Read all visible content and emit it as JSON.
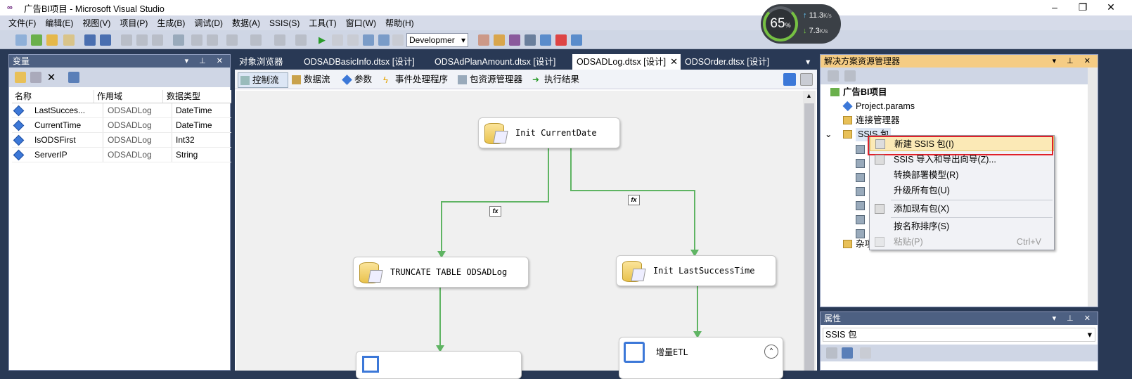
{
  "window": {
    "title": "广告BI项目 - Microsoft Visual Studio",
    "logo": "∞"
  },
  "menu": [
    "文件(F)",
    "编辑(E)",
    "视图(V)",
    "项目(P)",
    "生成(B)",
    "调试(D)",
    "数据(A)",
    "SSIS(S)",
    "工具(T)",
    "窗口(W)",
    "帮助(H)"
  ],
  "toolbar": {
    "config_value": "Developmer"
  },
  "perf": {
    "cpu_percent": "65",
    "cpu_unit": "%",
    "up": "11.3",
    "down": "7.3",
    "rate_unit": "K/s"
  },
  "variables": {
    "title": "变量",
    "columns": [
      "名称",
      "作用域",
      "数据类型"
    ],
    "rows": [
      {
        "name": "LastSucces...",
        "scope": "ODSADLog",
        "type": "DateTime"
      },
      {
        "name": "CurrentTime",
        "scope": "ODSADLog",
        "type": "DateTime"
      },
      {
        "name": "IsODSFirst",
        "scope": "ODSADLog",
        "type": "Int32"
      },
      {
        "name": "ServerIP",
        "scope": "ODSADLog",
        "type": "String"
      }
    ]
  },
  "doc_tabs": [
    "对象浏览器",
    "ODSADBasicInfo.dtsx [设计]",
    "ODSAdPlanAmount.dtsx [设计]",
    "ODSADLog.dtsx [设计]",
    "ODSOrder.dtsx [设计]"
  ],
  "designer_tabs": [
    "控制流",
    "数据流",
    "参数",
    "事件处理程序",
    "包资源管理器",
    "执行结果"
  ],
  "tasks": {
    "init_current": "Init CurrentDate",
    "truncate": "TRUNCATE TABLE ODSADLog",
    "init_last": "Init LastSuccessTime",
    "etl": "增量ETL"
  },
  "fx_label": "fx",
  "solution": {
    "title": "解决方案资源管理器",
    "project": "广告BI项目",
    "params": "Project.params",
    "conn": "连接管理器",
    "ssis": "SSIS 包",
    "misc": "杂项"
  },
  "context_menu": {
    "items": [
      "新建 SSIS 包(I)",
      "SSIS 导入和导出向导(Z)...",
      "转换部署模型(R)",
      "升级所有包(U)",
      "添加现有包(X)",
      "按名称排序(S)",
      "粘贴(P)"
    ],
    "paste_shortcut": "Ctrl+V"
  },
  "properties": {
    "title": "属性",
    "selected": "SSIS 包"
  },
  "colors": {
    "accent_header": "#f5cc84",
    "connector": "#5fb463",
    "highlight_box": "#e0202a"
  }
}
